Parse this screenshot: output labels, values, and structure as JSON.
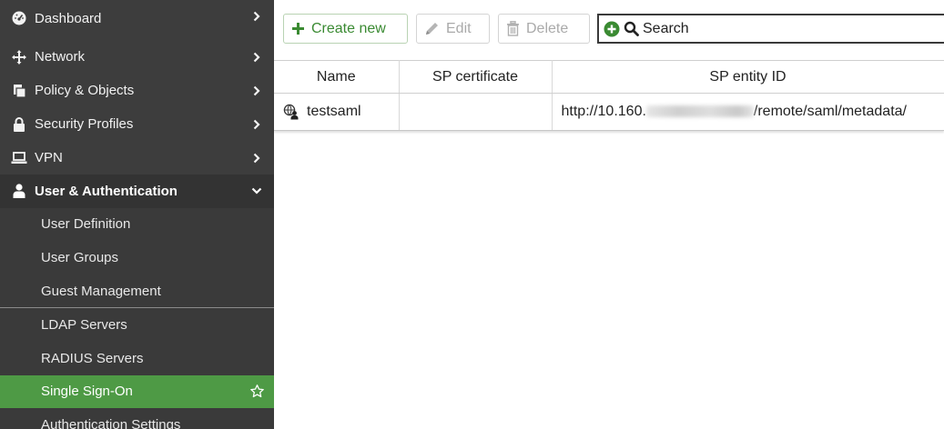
{
  "sidebar": {
    "items": [
      {
        "label": "Dashboard",
        "icon": "dashboard-icon"
      },
      {
        "label": "Network",
        "icon": "network-icon"
      },
      {
        "label": "Policy & Objects",
        "icon": "policy-objects-icon"
      },
      {
        "label": "Security Profiles",
        "icon": "lock-icon"
      },
      {
        "label": "VPN",
        "icon": "vpn-laptop-icon"
      }
    ],
    "expanded": {
      "label": "User & Authentication",
      "icon": "user-icon"
    },
    "subitems": [
      {
        "label": "User Definition"
      },
      {
        "label": "User Groups"
      },
      {
        "label": "Guest Management"
      },
      {
        "label": "LDAP Servers"
      },
      {
        "label": "RADIUS Servers"
      },
      {
        "label": "Single Sign-On",
        "active": true
      },
      {
        "label": "Authentication Settings"
      }
    ]
  },
  "toolbar": {
    "create_label": "Create new",
    "edit_label": "Edit",
    "delete_label": "Delete",
    "search_placeholder": "Search"
  },
  "table": {
    "columns": [
      "Name",
      "SP certificate",
      "SP entity ID"
    ],
    "rows": [
      {
        "name": "testsaml",
        "sp_certificate": "",
        "entity_prefix": "http://10.160.",
        "entity_suffix": "/remote/saml/metadata/"
      }
    ]
  },
  "colors": {
    "sidebar_bg": "#3d3d3d",
    "active_bg": "#4e9a45",
    "accent_green": "#3a8a32"
  }
}
